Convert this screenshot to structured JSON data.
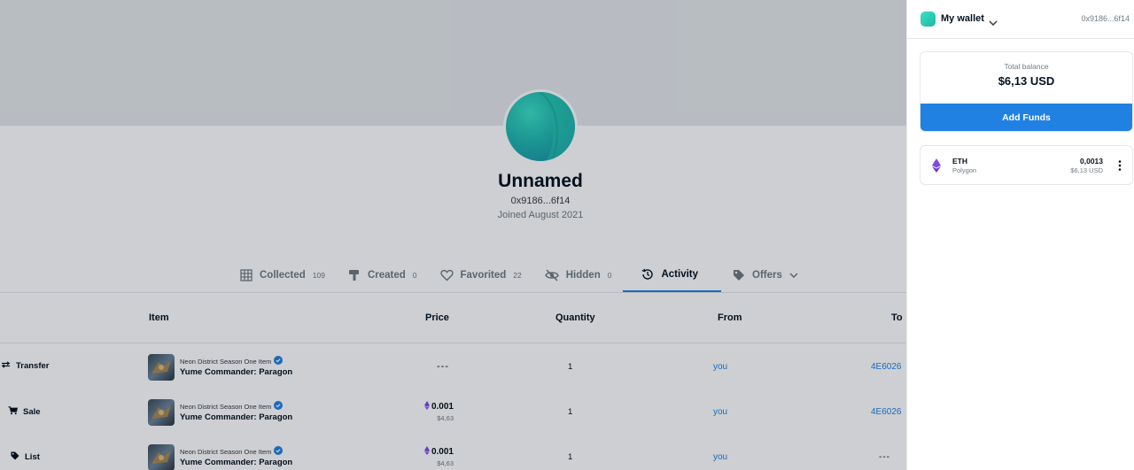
{
  "profile": {
    "name": "Unnamed",
    "address": "0x9186...6f14",
    "joined": "Joined August 2021"
  },
  "tabs": [
    {
      "label": "Collected",
      "count": "109",
      "icon": "grid-icon"
    },
    {
      "label": "Created",
      "count": "0",
      "icon": "brush-icon"
    },
    {
      "label": "Favorited",
      "count": "22",
      "icon": "heart-icon"
    },
    {
      "label": "Hidden",
      "count": "0",
      "icon": "eye-off-icon"
    },
    {
      "label": "Activity",
      "count": "",
      "icon": "history-icon",
      "active": true
    },
    {
      "label": "Offers",
      "count": "",
      "icon": "tag-icon"
    }
  ],
  "table": {
    "headers": {
      "item": "Item",
      "price": "Price",
      "quantity": "Quantity",
      "from": "From",
      "to": "To"
    },
    "rows": [
      {
        "event": "Transfer",
        "event_icon": "transfer-icon",
        "collection": "Neon District Season One Item",
        "item": "Yume Commander: Paragon",
        "price": "---",
        "price_usd": "",
        "quantity": "1",
        "from": "you",
        "to": "4E6026"
      },
      {
        "event": "Sale",
        "event_icon": "cart-icon",
        "collection": "Neon District Season One Item",
        "item": "Yume Commander: Paragon",
        "price": "0.001",
        "price_usd": "$4,63",
        "quantity": "1",
        "from": "you",
        "to": "4E6026"
      },
      {
        "event": "List",
        "event_icon": "tag-icon",
        "collection": "Neon District Season One Item",
        "item": "Yume Commander: Paragon",
        "price": "0.001",
        "price_usd": "$4,63",
        "quantity": "1",
        "from": "you",
        "to": "---"
      }
    ]
  },
  "wallet": {
    "title": "My wallet",
    "address": "0x9186...6f14",
    "balance_label": "Total balance",
    "balance_value": "$6,13 USD",
    "add_funds_label": "Add Funds",
    "token": {
      "symbol": "ETH",
      "network": "Polygon",
      "amount": "0,0013",
      "usd": "$6,13 USD"
    }
  },
  "colors": {
    "accent": "#2081e2",
    "text": "#04111d",
    "muted": "#707a83",
    "eth_purple": "#8247e5"
  }
}
